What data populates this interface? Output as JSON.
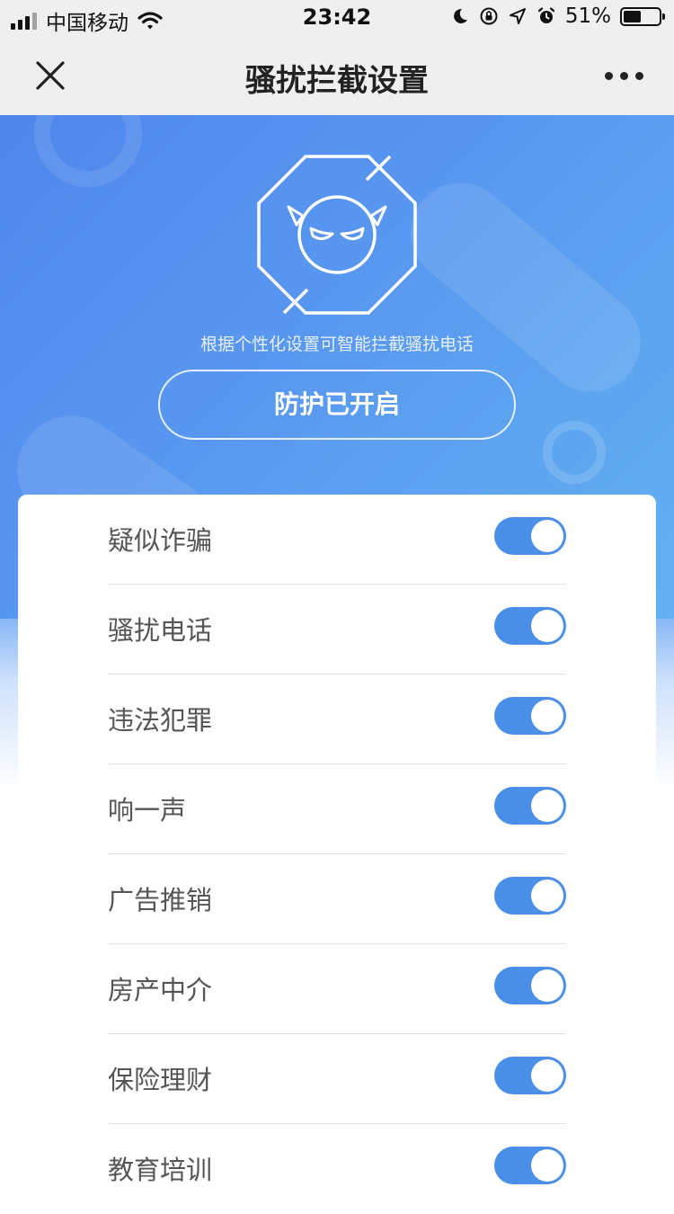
{
  "status_bar": {
    "carrier": "中国移动",
    "time": "23:42",
    "battery_percent": "51%",
    "battery_level": 0.51
  },
  "nav": {
    "title": "骚扰拦截设置",
    "close_icon": "close-icon",
    "more_icon": "more-dots-icon"
  },
  "hero": {
    "description": "根据个性化设置可智能拦截骚扰电话",
    "button_label": "防护已开启",
    "logo_icon": "devil-shield-icon"
  },
  "settings": [
    {
      "label": "疑似诈骗",
      "enabled": true
    },
    {
      "label": "骚扰电话",
      "enabled": true
    },
    {
      "label": "违法犯罪",
      "enabled": true
    },
    {
      "label": "响一声",
      "enabled": true
    },
    {
      "label": "广告推销",
      "enabled": true
    },
    {
      "label": "房产中介",
      "enabled": true
    },
    {
      "label": "保险理财",
      "enabled": true
    },
    {
      "label": "教育培训",
      "enabled": true
    }
  ],
  "colors": {
    "accent": "#4a8fe7",
    "hero_start": "#4f86ec",
    "hero_end": "#62b1f1"
  }
}
